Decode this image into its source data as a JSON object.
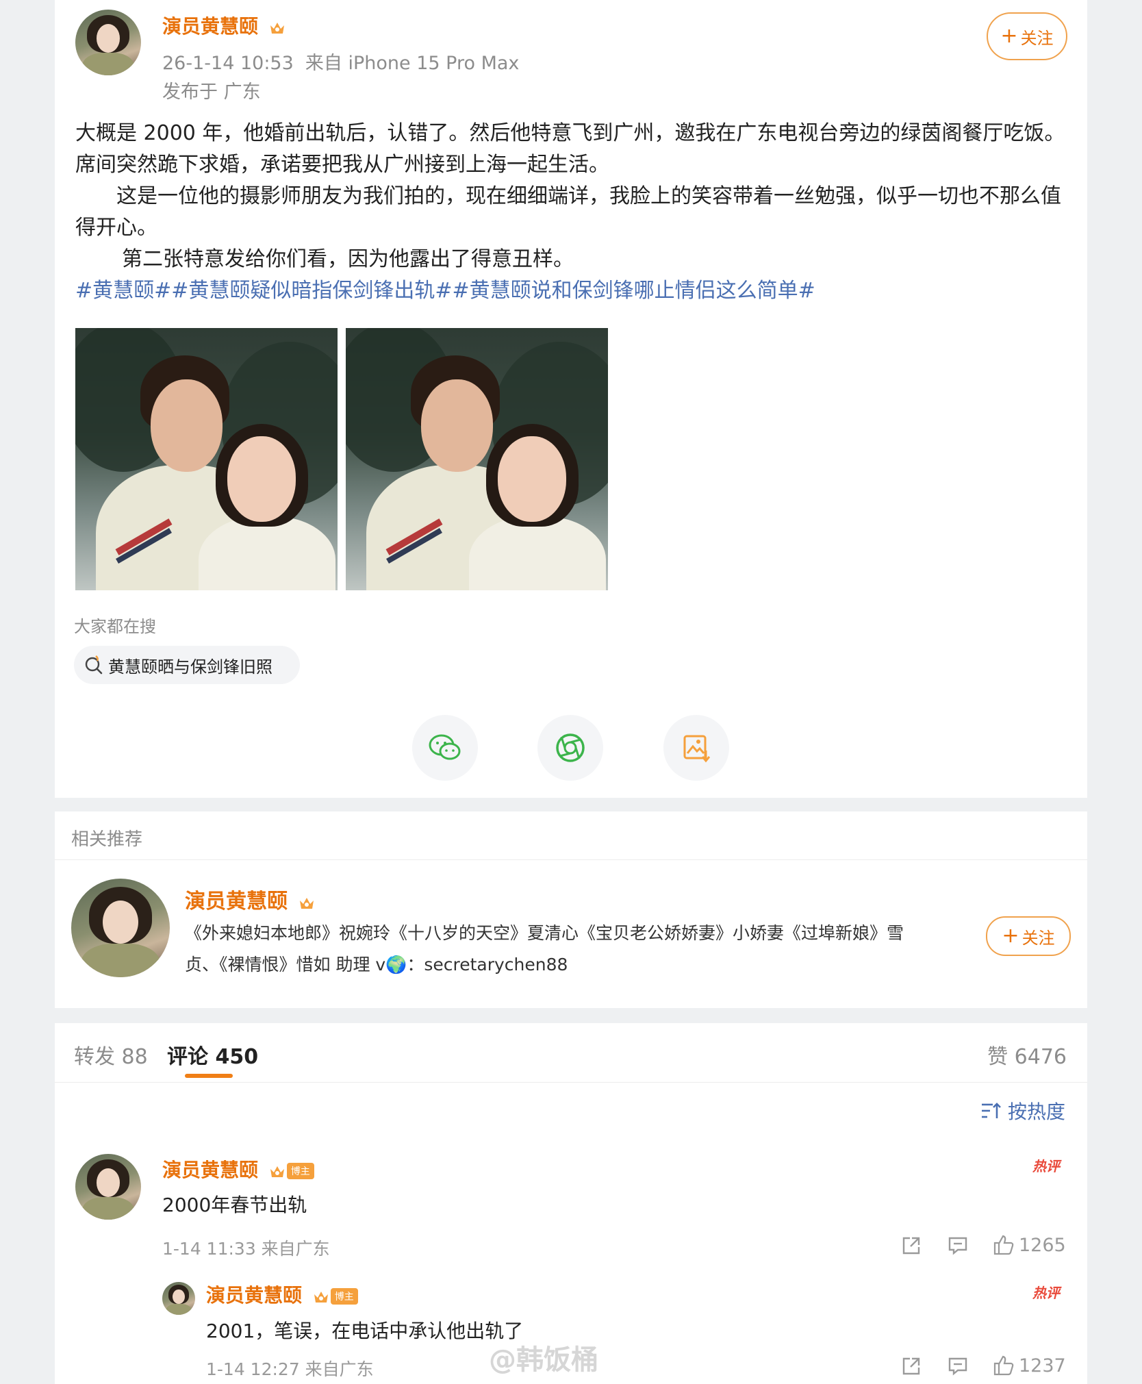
{
  "post": {
    "author": "演员黄慧颐",
    "time_source": "26-1-14 10:53  来自 iPhone 15 Pro Max",
    "location": "发布于 广东",
    "follow_label": "关注",
    "paragraph1": "大概是 2000 年，他婚前出轨后，认错了。然后他特意飞到广州，邀我在广东电视台旁边的绿茵阁餐厅吃饭。席间突然跪下求婚，承诺要把我从广州接到上海一起生活。",
    "paragraph2": "这是一位他的摄影师朋友为我们拍的，现在细细端详，我脸上的笑容带着一丝勉强，似乎一切也不那么值得开心。",
    "paragraph3": "第二张特意发给你们看，因为他露出了得意丑样。",
    "hashtags": "#黄慧颐##黄慧颐疑似暗指保剑锋出轨##黄慧颐说和保剑锋哪止情侣这么简单#",
    "search_label": "大家都在搜",
    "search_chip": "黄慧颐晒与保剑锋旧照"
  },
  "recommend": {
    "section_title": "相关推荐",
    "name": "演员黄慧颐",
    "desc": "《外来媳妇本地郎》祝婉玲《十八岁的天空》夏清心《宝贝老公娇娇妻》小娇妻《过埠新娘》雪贞、《裸情恨》惜如 助理 v🌍：secretarychen88",
    "follow_label": "关注"
  },
  "tabs": {
    "repost": "转发 88",
    "comments": "评论 450",
    "likes": "赞 6476",
    "sort": "按热度"
  },
  "comments": [
    {
      "name": "演员黄慧颐",
      "badge": "博主",
      "hot": "热评",
      "text": "2000年春节出轨",
      "meta": "1-14 11:33 来自广东",
      "likes": "1265"
    },
    {
      "name": "演员黄慧颐",
      "badge": "博主",
      "hot": "热评",
      "text": "2001，笔误，在电话中承认他出轨了",
      "meta": "1-14 12:27 来自广东",
      "likes": "1237"
    }
  ],
  "watermark": "@韩饭桶",
  "colors": {
    "accent_orange": "#e8720c",
    "link_blue": "#4a6fb2",
    "hot_red": "#e94a3b",
    "share_wechat": "#3cb44b"
  },
  "icons": {
    "share": [
      "wechat-icon",
      "moments-icon",
      "save-image-icon"
    ],
    "comment_actions": [
      "share-out-icon",
      "comment-icon",
      "thumb-up-icon"
    ]
  }
}
